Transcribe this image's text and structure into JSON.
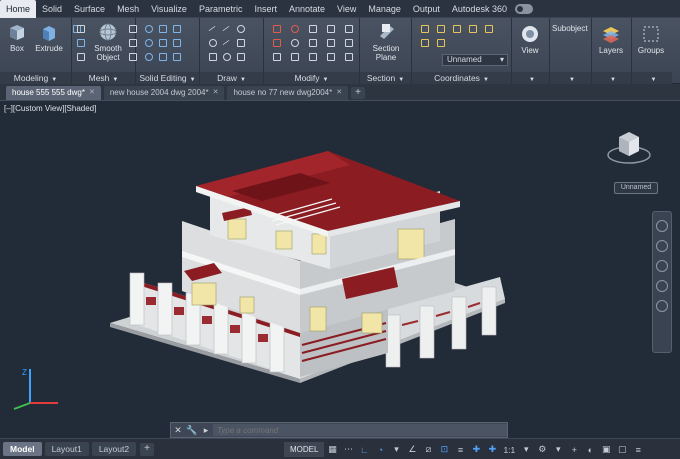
{
  "ribbon": {
    "tabs": [
      "Home",
      "Solid",
      "Surface",
      "Mesh",
      "Visualize",
      "Parametric",
      "Insert",
      "Annotate",
      "View",
      "Manage",
      "Output",
      "Autodesk 360"
    ],
    "active_tab": "Home",
    "panels": {
      "modeling": {
        "title": "Modeling",
        "box": "Box",
        "extrude": "Extrude"
      },
      "mesh": {
        "title": "Mesh",
        "smooth_line1": "Smooth",
        "smooth_line2": "Object"
      },
      "solid_editing": {
        "title": "Solid Editing"
      },
      "draw": {
        "title": "Draw"
      },
      "modify": {
        "title": "Modify"
      },
      "section": {
        "title": "Section",
        "plane_line1": "Section",
        "plane_line2": "Plane"
      },
      "coordinates": {
        "title": "Coordinates",
        "ucs_value": "Unnamed"
      },
      "view": {
        "label": "View"
      },
      "subobject": {
        "label": "Subobject"
      },
      "layers": {
        "label": "Layers"
      },
      "groups": {
        "label": "Groups"
      }
    }
  },
  "file_tabs": [
    {
      "label": "house 555 555 dwg*",
      "active": true
    },
    {
      "label": "new house 2004 dwg 2004*",
      "active": false
    },
    {
      "label": "house no 77 new dwg2004*",
      "active": false
    }
  ],
  "viewport": {
    "label": "[–][Custom View][Shaded]",
    "viewcube_named": "Unnamed"
  },
  "command": {
    "placeholder": "Type a command"
  },
  "layout_tabs": [
    {
      "label": "Model",
      "active": true
    },
    {
      "label": "Layout1",
      "active": false
    },
    {
      "label": "Layout2",
      "active": false
    }
  ],
  "status": {
    "model": "MODEL",
    "scale": "1:1"
  },
  "colors": {
    "roof": "#8a1c22",
    "wall": "#dcdedf",
    "window": "#f1e6a8",
    "accent": "#4fa3ff"
  }
}
